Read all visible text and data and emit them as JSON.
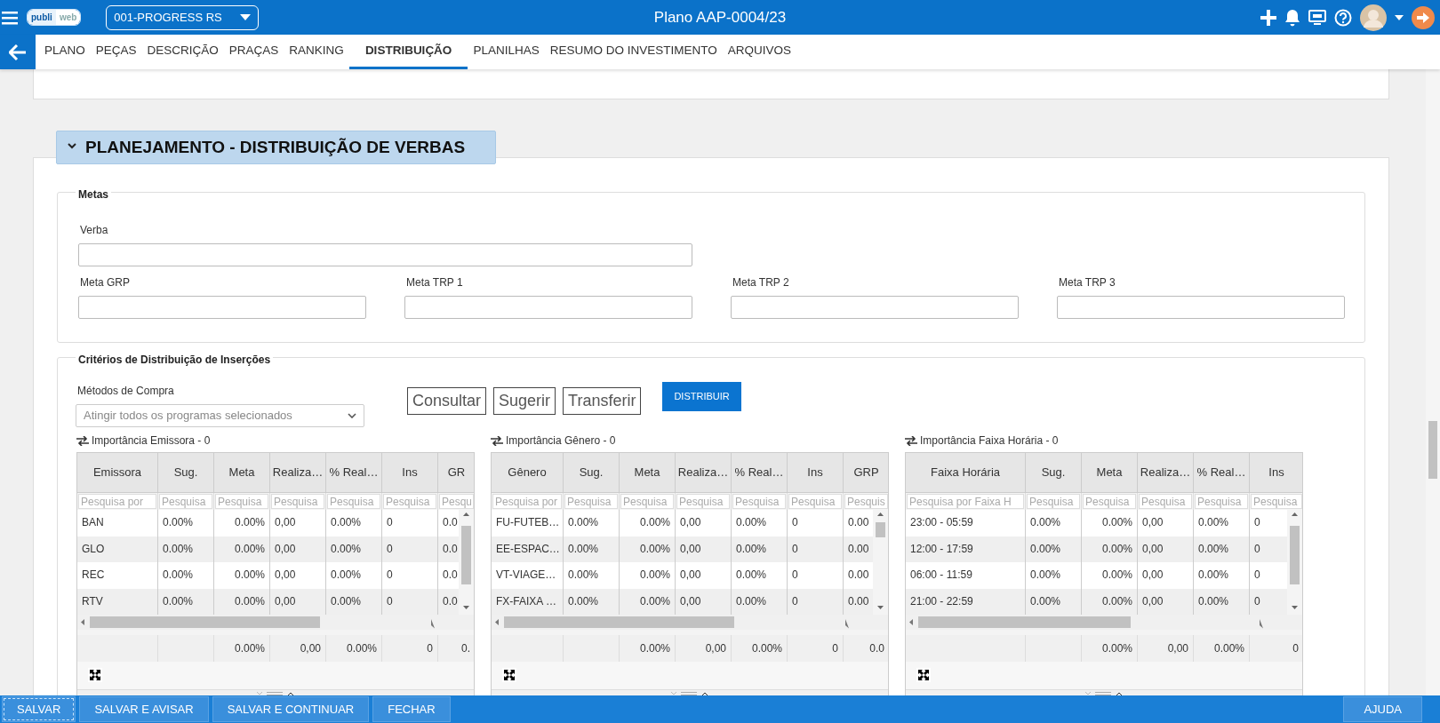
{
  "topbar": {
    "logo": [
      "publi",
      "web"
    ],
    "plan_select": "001-PROGRESS RS",
    "title": "Plano AAP-0004/23"
  },
  "tabs": [
    {
      "label": "PLANO",
      "selected": false
    },
    {
      "label": "PEÇAS",
      "selected": false
    },
    {
      "label": "DESCRIÇÃO",
      "selected": false
    },
    {
      "label": "PRAÇAS",
      "selected": false
    },
    {
      "label": "RANKING",
      "selected": false
    },
    {
      "label": "DISTRIBUIÇÃO",
      "selected": true
    },
    {
      "label": "PLANILHAS",
      "selected": false
    },
    {
      "label": "RESUMO DO INVESTIMENTO",
      "selected": false
    },
    {
      "label": "ARQUIVOS",
      "selected": false
    }
  ],
  "section": {
    "title": "PLANEJAMENTO - DISTRIBUIÇÃO DE VERBAS",
    "expanded": true
  },
  "metas": {
    "legend": "Metas",
    "fields": [
      {
        "label": "Verba",
        "kind": "wide"
      },
      {
        "label": "Meta GRP",
        "kind": "normal"
      },
      {
        "label": "Meta TRP 1",
        "kind": "normal"
      },
      {
        "label": "Meta TRP 2",
        "kind": "normal"
      },
      {
        "label": "Meta TRP 3",
        "kind": "normal"
      }
    ]
  },
  "criteria": {
    "legend": "Critérios de Distribuição de Inserções",
    "method": {
      "label": "Métodos de Compra",
      "value": "Atingir todos os programas selecionados"
    },
    "buttons": [
      {
        "label": "Consultar",
        "kind": "outline"
      },
      {
        "label": "Sugerir",
        "kind": "outline"
      },
      {
        "label": "Transferir",
        "kind": "outline"
      },
      {
        "label": "DISTRIBUIR",
        "kind": "primary"
      }
    ],
    "grids": [
      {
        "title": "Importância Emissora - 0",
        "columns": [
          {
            "label": "Emissora",
            "placeholder": "Pesquisa por"
          },
          {
            "label": "Sug.",
            "placeholder": "Pesquisa"
          },
          {
            "label": "Meta",
            "placeholder": "Pesquisa"
          },
          {
            "label": "Realiza…",
            "placeholder": "Pesquisa"
          },
          {
            "label": "% Real…",
            "placeholder": "Pesquisa"
          },
          {
            "label": "Ins",
            "placeholder": "Pesquisa"
          },
          {
            "label": "GR",
            "placeholder": "Pesqu"
          }
        ],
        "rows": [
          [
            "BAN",
            "0.00%",
            "0.00%",
            "0,00",
            "0.00%",
            "0",
            "0.0"
          ],
          [
            "GLO",
            "0.00%",
            "0.00%",
            "0,00",
            "0.00%",
            "0",
            "0.0"
          ],
          [
            "REC",
            "0.00%",
            "0.00%",
            "0,00",
            "0.00%",
            "0",
            "0.0"
          ],
          [
            "RTV",
            "0.00%",
            "0.00%",
            "0,00",
            "0.00%",
            "0",
            "0.0"
          ]
        ],
        "totals": [
          "0.00%",
          "0,00",
          "0.00%",
          "0",
          "0."
        ]
      },
      {
        "title": "Importância Gênero - 0",
        "columns": [
          {
            "label": "Gênero",
            "placeholder": "Pesquisa por"
          },
          {
            "label": "Sug.",
            "placeholder": "Pesquisa"
          },
          {
            "label": "Meta",
            "placeholder": "Pesquisa"
          },
          {
            "label": "Realiza…",
            "placeholder": "Pesquisa"
          },
          {
            "label": "% Real…",
            "placeholder": "Pesquisa"
          },
          {
            "label": "Ins",
            "placeholder": "Pesquisa"
          },
          {
            "label": "GRP",
            "placeholder": "Pesquis"
          }
        ],
        "rows": [
          [
            "FU-FUTEB…",
            "0.00%",
            "0.00%",
            "0,00",
            "0.00%",
            "0",
            "0.00"
          ],
          [
            "EE-ESPAC…",
            "0.00%",
            "0.00%",
            "0,00",
            "0.00%",
            "0",
            "0.00"
          ],
          [
            "VT-VIAGE…",
            "0.00%",
            "0.00%",
            "0,00",
            "0.00%",
            "0",
            "0.00"
          ],
          [
            "FX-FAIXA …",
            "0.00%",
            "0.00%",
            "0,00",
            "0.00%",
            "0",
            "0.00"
          ]
        ],
        "totals": [
          "0.00%",
          "0,00",
          "0.00%",
          "0",
          "0.0"
        ]
      },
      {
        "title": "Importância Faixa Horária - 0",
        "columns": [
          {
            "label": "Faixa Horária",
            "placeholder": "Pesquisa por Faixa H"
          },
          {
            "label": "Sug.",
            "placeholder": "Pesquisa"
          },
          {
            "label": "Meta",
            "placeholder": "Pesquisa"
          },
          {
            "label": "Realiza…",
            "placeholder": "Pesquisa"
          },
          {
            "label": "% Real…",
            "placeholder": "Pesquisa"
          },
          {
            "label": "Ins",
            "placeholder": "Pesquisa"
          }
        ],
        "rows": [
          [
            "23:00 - 05:59",
            "0.00%",
            "0.00%",
            "0,00",
            "0.00%",
            "0"
          ],
          [
            "12:00 - 17:59",
            "0.00%",
            "0.00%",
            "0,00",
            "0.00%",
            "0"
          ],
          [
            "06:00 - 11:59",
            "0.00%",
            "0.00%",
            "0,00",
            "0.00%",
            "0"
          ],
          [
            "21:00 - 22:59",
            "0.00%",
            "0.00%",
            "0,00",
            "0.00%",
            "0"
          ]
        ],
        "totals": [
          "0.00%",
          "0,00",
          "0.00%",
          "0"
        ]
      }
    ]
  },
  "actions": [
    {
      "label": "SALVAR",
      "focused": true
    },
    {
      "label": "SALVAR E AVISAR",
      "focused": false
    },
    {
      "label": "SALVAR E CONTINUAR",
      "focused": false
    },
    {
      "label": "FECHAR",
      "focused": false
    }
  ],
  "help_button": "AJUDA"
}
